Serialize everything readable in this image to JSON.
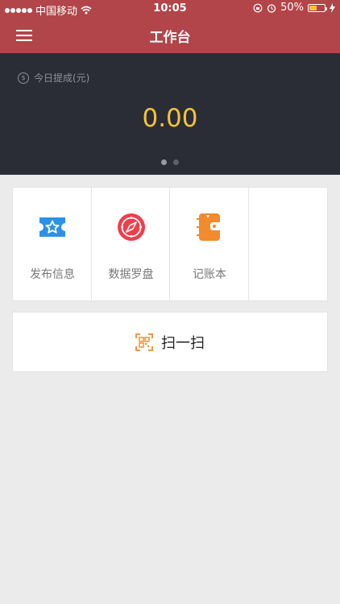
{
  "status": {
    "carrier": "中国移动",
    "time": "10:05",
    "battery": "50%",
    "battery_level": 0.5
  },
  "header": {
    "title": "工作台"
  },
  "hero": {
    "label": "今日提成(元)",
    "value": "0.00",
    "page_count": 2,
    "active_page": 1
  },
  "tools": [
    {
      "label": "发布信息",
      "icon": "ticket-star-icon",
      "color": "#2b91e6"
    },
    {
      "label": "数据罗盘",
      "icon": "compass-icon",
      "color": "#ef3f4b"
    },
    {
      "label": "记账本",
      "icon": "wallet-book-icon",
      "color": "#f18b2d"
    }
  ],
  "scan": {
    "label": "扫一扫",
    "icon": "qr-scan-icon",
    "color": "#f18b2d"
  }
}
